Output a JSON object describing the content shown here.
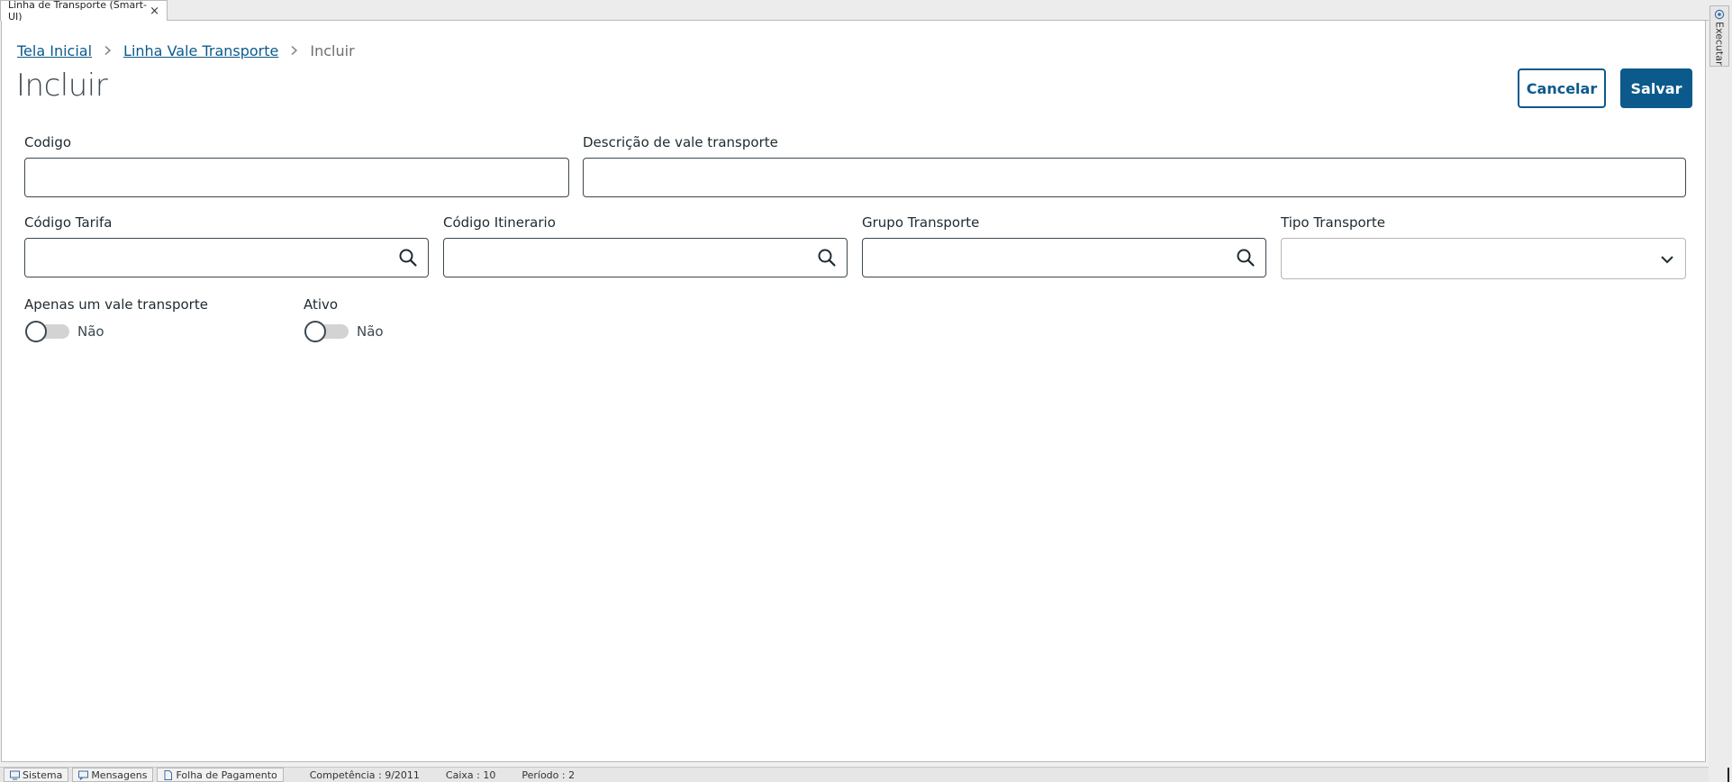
{
  "window": {
    "tab_title": "Linha de Transporte (Smart-UI)",
    "tab_close": "×",
    "side_panel_label": "Executar"
  },
  "breadcrumb": {
    "home": "Tela Inicial",
    "parent": "Linha Vale Transporte",
    "current": "Incluir"
  },
  "page": {
    "title": "Incluir"
  },
  "actions": {
    "cancel_label": "Cancelar",
    "save_label": "Salvar"
  },
  "form": {
    "codigo": {
      "label": "Codigo",
      "value": ""
    },
    "descricao": {
      "label": "Descrição de vale transporte",
      "value": ""
    },
    "codigo_tarifa": {
      "label": "Código Tarifa",
      "value": "",
      "icon": "search-icon"
    },
    "codigo_itinerario": {
      "label": "Código Itinerario",
      "value": "",
      "icon": "search-icon"
    },
    "grupo_transporte": {
      "label": "Grupo Transporte",
      "value": "",
      "icon": "search-icon"
    },
    "tipo_transporte": {
      "label": "Tipo Transporte",
      "selected": "",
      "icon": "chevron-down-icon"
    },
    "apenas_um_vale": {
      "label": "Apenas um vale transporte",
      "state_text": "Não",
      "on": false
    },
    "ativo": {
      "label": "Ativo",
      "state_text": "Não",
      "on": false
    }
  },
  "status_bar": {
    "sistema": "Sistema",
    "mensagens": "Mensagens",
    "modulo": "Folha de Pagamento",
    "competencia": "Competência : 9/2011",
    "caixa": "Caixa : 10",
    "periodo": "Período : 2"
  },
  "colors": {
    "primary": "#0c5a8c",
    "text": "#1f2a30",
    "border": "#3c4850"
  }
}
